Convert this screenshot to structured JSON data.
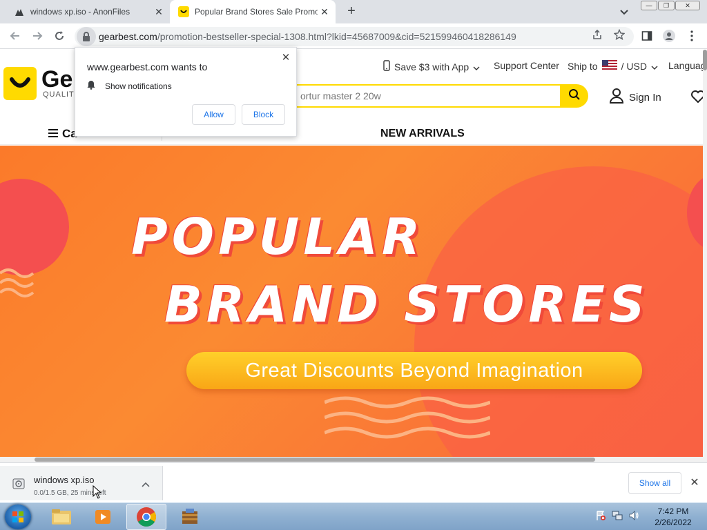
{
  "browser": {
    "tabs": [
      {
        "title": "windows xp.iso - AnonFiles",
        "active": false,
        "icon": "anonfiles-icon"
      },
      {
        "title": "Popular Brand Stores Sale Promo",
        "active": true,
        "icon": "gearbest-favicon"
      }
    ],
    "url_host": "gearbest.com",
    "url_rest": "/promotion-bestseller-special-1308.html?lkid=45687009&cid=521599460418286149"
  },
  "permission_popup": {
    "title": "www.gearbest.com wants to",
    "request": "Show notifications",
    "allow_label": "Allow",
    "block_label": "Block"
  },
  "site": {
    "logo_text": "Ge",
    "logo_sub": "QUALITY",
    "brand_color": "#ffda00",
    "topnav": {
      "app": "Save $3 with App",
      "support": "Support Center",
      "ship_to": "Ship to",
      "currency": "/ USD",
      "language": "Languag"
    },
    "search_placeholder": "ortur master 2 20w",
    "sign_in": "Sign In",
    "category_label": "Ca",
    "new_arrivals": "NEW ARRIVALS"
  },
  "hero": {
    "line1": "POPULAR",
    "line2": "BRAND STORES",
    "pill": "Great Discounts Beyond Imagination",
    "bg_color": "#fb7a2a"
  },
  "download": {
    "filename": "windows xp.iso",
    "status": "0.0/1.5 GB, 25 mins left",
    "show_all": "Show all"
  },
  "taskbar": {
    "time": "7:42 PM",
    "date": "2/26/2022"
  }
}
